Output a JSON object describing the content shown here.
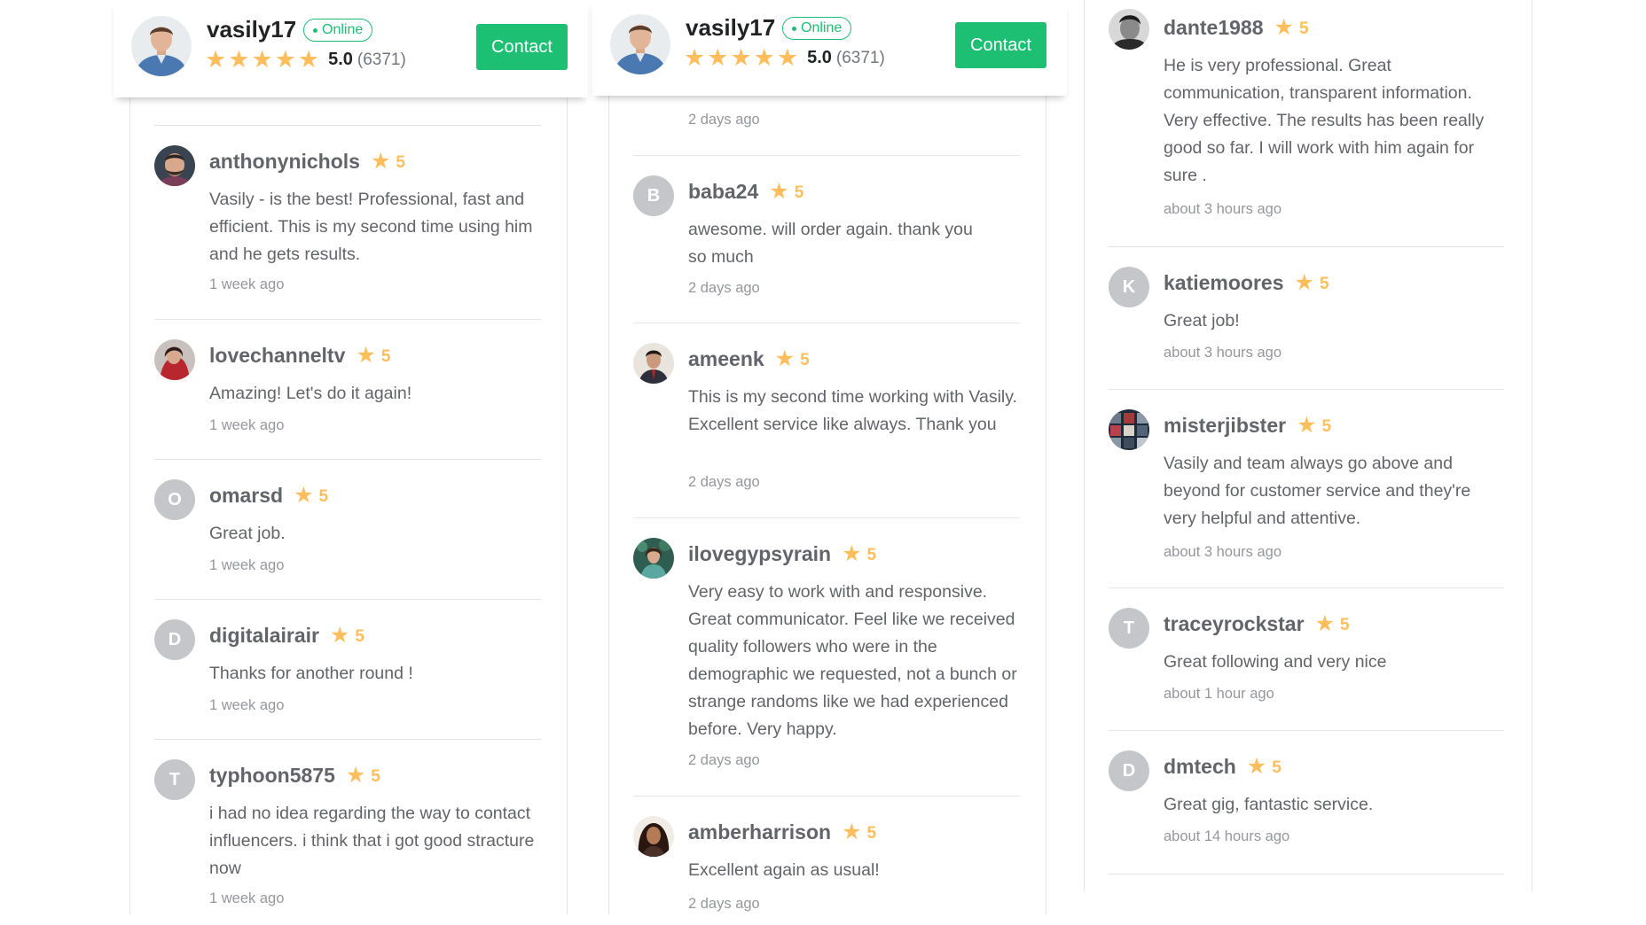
{
  "profile": {
    "username": "vasily17",
    "status": "Online",
    "rating": "5.0",
    "review_count": "(6371)",
    "contact_label": "Contact"
  },
  "column1": {
    "reviews": [
      {
        "username": "anthonynichols",
        "rating": "5",
        "text": "Vasily - is the best! Professional, fast and efficient. This is my second time using him and he gets results.",
        "time": "1 week ago"
      },
      {
        "username": "lovechanneltv",
        "rating": "5",
        "text": "Amazing! Let's do it again!",
        "time": "1 week ago"
      },
      {
        "username": "omarsd",
        "initial": "O",
        "rating": "5",
        "text": "Great job.",
        "time": "1 week ago"
      },
      {
        "username": "digitalairair",
        "initial": "D",
        "rating": "5",
        "text": "Thanks for another round !",
        "time": "1 week ago"
      },
      {
        "username": "typhoon5875",
        "initial": "T",
        "rating": "5",
        "text": "i had no idea regarding the way to contact influencers. i think that i got good stracture now",
        "time": "1 week ago"
      }
    ]
  },
  "column2": {
    "partial_time": "2 days ago",
    "reviews": [
      {
        "username": "baba24",
        "initial": "B",
        "rating": "5",
        "text": "awesome. will order again. thank you so much",
        "time": "2 days ago"
      },
      {
        "username": "ameenk",
        "rating": "5",
        "text": "This is my second time working with Vasily. Excellent service like always. Thank you",
        "time": "2 days ago"
      },
      {
        "username": "ilovegypsyrain",
        "rating": "5",
        "text": "Very easy to work with and responsive. Great communicator. Feel like we received quality followers who were in the demographic we requested, not a bunch or strange randoms like we had experienced before. Very happy.",
        "time": "2 days ago"
      },
      {
        "username": "amberharrison",
        "rating": "5",
        "text": "Excellent again as usual!",
        "time": "2 days ago"
      }
    ]
  },
  "column3": {
    "reviews": [
      {
        "username": "dante1988",
        "rating": "5",
        "text": "He is very professional. Great communication, transparent information. Very effective. The results has been really good so far. I will work with him again for sure .",
        "time": "about 3 hours ago"
      },
      {
        "username": "katiemoores",
        "initial": "K",
        "rating": "5",
        "text": "Great job!",
        "time": "about 3 hours ago"
      },
      {
        "username": "misterjibster",
        "rating": "5",
        "text": "Vasily and team always go above and beyond for customer service and they're very helpful and attentive.",
        "time": "about 3 hours ago"
      },
      {
        "username": "traceyrockstar",
        "initial": "T",
        "rating": "5",
        "text": "Great following and very nice",
        "time": "about 1 hour ago"
      },
      {
        "username": "dmtech",
        "initial": "D",
        "rating": "5",
        "text": "Great gig, fantastic service.",
        "time": "about 14 hours ago"
      }
    ]
  },
  "colors": {
    "accent_green": "#1dbf73",
    "star_yellow": "#ffbe5b",
    "text_gray": "#62646a",
    "muted_gray": "#95979d",
    "letter_avatar_gray": "#c5c6c9"
  },
  "icons": {
    "star": "star-icon",
    "online_dot": "online-dot-icon"
  }
}
